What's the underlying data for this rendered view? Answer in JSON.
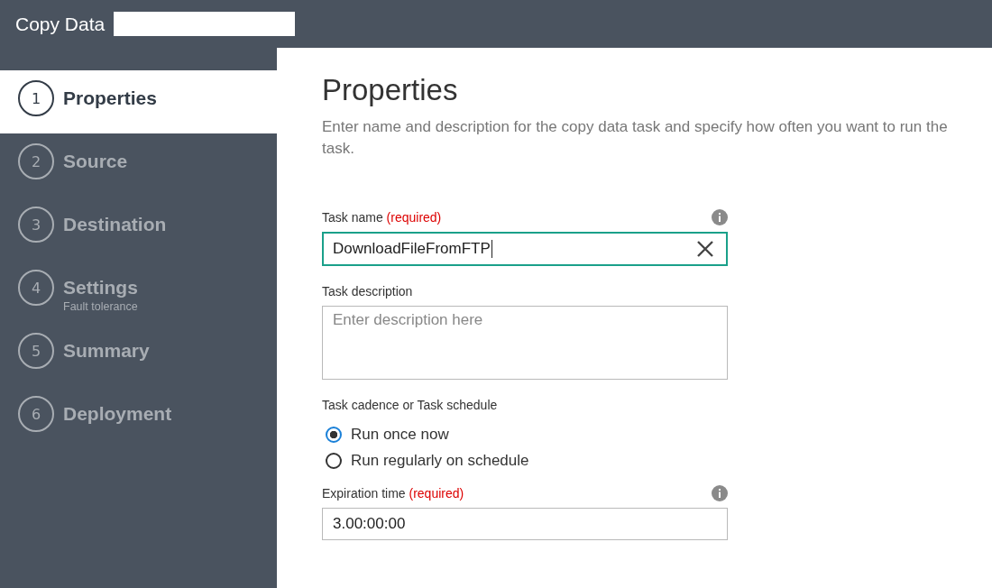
{
  "header": {
    "title": "Copy Data"
  },
  "steps": [
    {
      "number": "1",
      "label": "Properties",
      "selected": true
    },
    {
      "number": "2",
      "label": "Source",
      "selected": false
    },
    {
      "number": "3",
      "label": "Destination",
      "selected": false
    },
    {
      "number": "4",
      "label": "Settings",
      "sublabel": "Fault tolerance",
      "selected": false
    },
    {
      "number": "5",
      "label": "Summary",
      "selected": false
    },
    {
      "number": "6",
      "label": "Deployment",
      "selected": false
    }
  ],
  "content": {
    "title": "Properties",
    "description": "Enter name and description for the copy data task and specify how often you want to run the task.",
    "fields": [
      {
        "kind": "text",
        "label": "Task name",
        "required": "(required)",
        "value": "DownloadFileFromFTP",
        "focused": true,
        "info": true,
        "clear": true
      },
      {
        "kind": "textarea",
        "label": "Task description",
        "placeholder": "Enter description here"
      },
      {
        "kind": "radio",
        "label": "Task cadence or Task schedule",
        "options": [
          {
            "label": "Run once now",
            "selected": true
          },
          {
            "label": "Run regularly on schedule",
            "selected": false
          }
        ]
      },
      {
        "kind": "text",
        "label": "Expiration time",
        "required": "(required)",
        "value": "3.00:00:00",
        "focused": false,
        "info": true,
        "clear": false
      }
    ]
  }
}
